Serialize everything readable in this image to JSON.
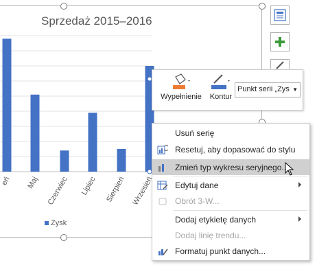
{
  "chart": {
    "title": "Sprzedaż 2015–2016",
    "legend_label": "Zysk",
    "bar_color": "#4472c4"
  },
  "chart_data": {
    "type": "bar",
    "title": "Sprzedaż 2015–2016",
    "categories": [
      "Kwiecień",
      "Maj",
      "Czerwiec",
      "Lipiec",
      "Sierpień",
      "Wrzesień"
    ],
    "visible_category_labels": [
      "eń",
      "Maj",
      "Czerwiec",
      "Lipiec",
      "Sierpień",
      "Wrzesień"
    ],
    "series": [
      {
        "name": "Zysk",
        "values": [
          8.8,
          5.1,
          1.4,
          3.9,
          1.5,
          7.0
        ]
      }
    ],
    "grid": true,
    "legend": "bottom"
  },
  "side_buttons": [
    "chart-layout-icon",
    "chart-elements-plus-icon",
    "chart-styles-brush-icon"
  ],
  "mini_toolbar": {
    "fill_label": "Wypełnienie",
    "outline_label": "Kontur",
    "series_select_value": "Punkt serii „Zys",
    "fill_color": "#ed7d31",
    "outline_color": "#4472c4"
  },
  "context_menu": {
    "items": [
      {
        "label": "Usuń serię",
        "icon": "",
        "disabled": false
      },
      {
        "label": "Resetuj, aby dopasować do stylu",
        "icon": "reset-style-icon",
        "disabled": false
      },
      {
        "label": "Zmień typ wykresu seryjnego...",
        "icon": "chart-type-icon",
        "disabled": false,
        "highlighted": true
      },
      {
        "label": "Edytuj dane",
        "icon": "edit-data-icon",
        "disabled": false,
        "submenu": true
      },
      {
        "label": "Obrót 3-W...",
        "icon": "rotate-3d-icon",
        "disabled": true
      },
      {
        "label": "Dodaj etykietę danych",
        "icon": "",
        "disabled": false,
        "submenu": true
      },
      {
        "label": "Dodaj linię trendu...",
        "icon": "",
        "disabled": true
      },
      {
        "label": "Formatuj punkt danych...",
        "icon": "format-data-point-icon",
        "disabled": false
      }
    ]
  }
}
